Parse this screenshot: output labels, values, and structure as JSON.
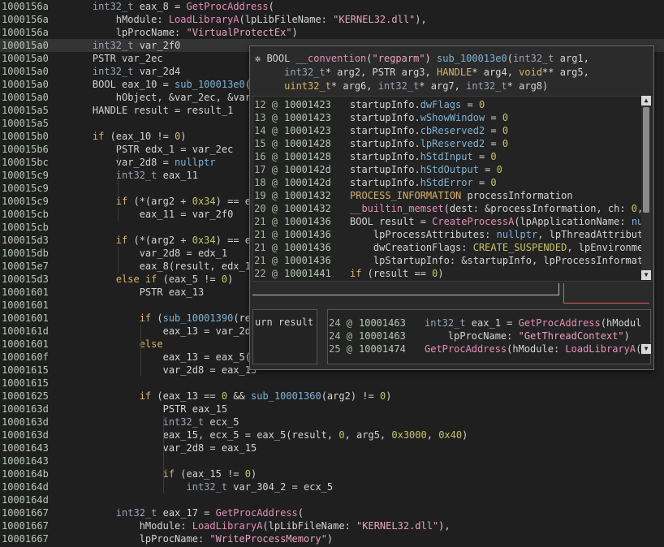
{
  "main_rows": [
    {
      "addr": "1000156a",
      "code": [
        [
          "    ",
          "d"
        ],
        [
          "int32_t",
          "t"
        ],
        [
          " eax_8 = ",
          "d"
        ],
        [
          "GetProcAddress",
          "f"
        ],
        [
          "(",
          "d"
        ]
      ]
    },
    {
      "addr": "1000156a",
      "code": [
        [
          "        hModule: ",
          "d"
        ],
        [
          "LoadLibraryA",
          "f"
        ],
        [
          "(lpLibFileName: ",
          "d"
        ],
        [
          "\"KERNEL32.dll\"",
          "s"
        ],
        [
          "),",
          "d"
        ]
      ]
    },
    {
      "addr": "1000156a",
      "code": [
        [
          "        lpProcName: ",
          "d"
        ],
        [
          "\"VirtualProtectEx\"",
          "s"
        ],
        [
          ")",
          "d"
        ]
      ]
    },
    {
      "addr": "100015a0",
      "code": [
        [
          "    ",
          "d"
        ],
        [
          "int32_t",
          "t"
        ],
        [
          " var_2f0",
          "d"
        ]
      ],
      "hl": true
    },
    {
      "addr": "100015a0",
      "code": [
        [
          "    PSTR var_2ec",
          "d"
        ]
      ]
    },
    {
      "addr": "100015a0",
      "code": [
        [
          "    ",
          "d"
        ],
        [
          "int32_t",
          "t"
        ],
        [
          " var_2d4",
          "d"
        ]
      ]
    },
    {
      "addr": "100015a0",
      "code": [
        [
          "    BOOL eax_10 = ",
          "d"
        ],
        [
          "sub_100013e0",
          "fld"
        ],
        [
          "(8",
          "d"
        ]
      ]
    },
    {
      "addr": "100015a0",
      "code": [
        [
          "        hObject, &var_2ec, &var_",
          "d"
        ]
      ]
    },
    {
      "addr": "100015a5",
      "code": [
        [
          "    HANDLE result = result_1",
          "d"
        ]
      ]
    },
    {
      "addr": "100015a5",
      "code": [
        [
          "",
          "d"
        ]
      ]
    },
    {
      "addr": "100015b0",
      "code": [
        [
          "    ",
          "d"
        ],
        [
          "if",
          "k"
        ],
        [
          " (eax_10 != ",
          "d"
        ],
        [
          "0",
          "n"
        ],
        [
          ")",
          "d"
        ]
      ]
    },
    {
      "addr": "100015b6",
      "code": [
        [
          "        PSTR edx_1 = var_2ec",
          "d"
        ]
      ]
    },
    {
      "addr": "100015bc",
      "code": [
        [
          "        var_2d8 = ",
          "d"
        ],
        [
          "nullptr",
          "fld"
        ]
      ]
    },
    {
      "addr": "100015c9",
      "code": [
        [
          "        ",
          "d"
        ],
        [
          "int32_t",
          "t"
        ],
        [
          " eax_11",
          "d"
        ]
      ]
    },
    {
      "addr": "100015c9",
      "code": [
        [
          "",
          "d"
        ]
      ]
    },
    {
      "addr": "100015c9",
      "code": [
        [
          "        ",
          "d"
        ],
        [
          "if",
          "k"
        ],
        [
          " (*(arg2 + ",
          "d"
        ],
        [
          "0x34",
          "n"
        ],
        [
          ") == ed",
          "d"
        ]
      ]
    },
    {
      "addr": "100015cb",
      "code": [
        [
          "            eax_11 = var_2f0",
          "d"
        ]
      ]
    },
    {
      "addr": "100015cb",
      "code": [
        [
          "",
          "d"
        ]
      ]
    },
    {
      "addr": "100015d3",
      "code": [
        [
          "        ",
          "d"
        ],
        [
          "if",
          "k"
        ],
        [
          " (*(arg2 + ",
          "d"
        ],
        [
          "0x34",
          "n"
        ],
        [
          ") == ed",
          "d"
        ]
      ]
    },
    {
      "addr": "100015db",
      "code": [
        [
          "            var_2d8 = edx_1",
          "d"
        ]
      ]
    },
    {
      "addr": "100015e7",
      "code": [
        [
          "            eax_8(result, edx_1,",
          "d"
        ]
      ]
    },
    {
      "addr": "100015d3",
      "code": [
        [
          "        ",
          "d"
        ],
        [
          "else if",
          "k"
        ],
        [
          " (eax_5 != ",
          "d"
        ],
        [
          "0",
          "n"
        ],
        [
          ")",
          "d"
        ]
      ]
    },
    {
      "addr": "10001601",
      "code": [
        [
          "            PSTR eax_13",
          "d"
        ]
      ]
    },
    {
      "addr": "10001601",
      "code": [
        [
          "",
          "d"
        ]
      ]
    },
    {
      "addr": "10001601",
      "code": [
        [
          "            ",
          "d"
        ],
        [
          "if",
          "k"
        ],
        [
          " (",
          "d"
        ],
        [
          "sub_10001390",
          "fld"
        ],
        [
          "(res",
          "d"
        ]
      ]
    },
    {
      "addr": "1000161d",
      "code": [
        [
          "                eax_13 = var_2d8",
          "d"
        ]
      ]
    },
    {
      "addr": "10001601",
      "code": [
        [
          "            ",
          "d"
        ],
        [
          "else",
          "k"
        ]
      ]
    },
    {
      "addr": "1000160f",
      "code": [
        [
          "                eax_13 = eax_5(r",
          "d"
        ]
      ]
    },
    {
      "addr": "10001615",
      "code": [
        [
          "                var_2d8 = eax_13",
          "d"
        ]
      ]
    },
    {
      "addr": "10001615",
      "code": [
        [
          "",
          "d"
        ]
      ]
    },
    {
      "addr": "10001625",
      "code": [
        [
          "            ",
          "d"
        ],
        [
          "if",
          "k"
        ],
        [
          " (eax_13 == ",
          "d"
        ],
        [
          "0",
          "n"
        ],
        [
          " && ",
          "d"
        ],
        [
          "sub_10001360",
          "fld"
        ],
        [
          "(arg2) != ",
          "d"
        ],
        [
          "0",
          "n"
        ],
        [
          ")",
          "d"
        ]
      ]
    },
    {
      "addr": "1000163d",
      "code": [
        [
          "                PSTR eax_15",
          "d"
        ]
      ]
    },
    {
      "addr": "1000163d",
      "code": [
        [
          "                ",
          "d"
        ],
        [
          "int32_t",
          "t"
        ],
        [
          " ecx_5",
          "d"
        ]
      ]
    },
    {
      "addr": "1000163d",
      "code": [
        [
          "                eax_15, ecx_5 = eax_5(result, ",
          "d"
        ],
        [
          "0",
          "n"
        ],
        [
          ", arg5, ",
          "d"
        ],
        [
          "0x3000",
          "n"
        ],
        [
          ", ",
          "d"
        ],
        [
          "0x40",
          "n"
        ],
        [
          ")",
          "d"
        ]
      ]
    },
    {
      "addr": "10001643",
      "code": [
        [
          "                var_2d8 = eax_15",
          "d"
        ]
      ]
    },
    {
      "addr": "10001643",
      "code": [
        [
          "",
          "d"
        ]
      ]
    },
    {
      "addr": "1000164b",
      "code": [
        [
          "                ",
          "d"
        ],
        [
          "if",
          "k"
        ],
        [
          " (eax_15 != ",
          "d"
        ],
        [
          "0",
          "n"
        ],
        [
          ")",
          "d"
        ]
      ]
    },
    {
      "addr": "1000164d",
      "code": [
        [
          "                    ",
          "d"
        ],
        [
          "int32_t",
          "t"
        ],
        [
          " var_304_2 = ecx_5",
          "d"
        ]
      ]
    },
    {
      "addr": "1000164d",
      "code": [
        [
          "",
          "d"
        ]
      ]
    },
    {
      "addr": "10001667",
      "code": [
        [
          "        ",
          "d"
        ],
        [
          "int32_t",
          "t"
        ],
        [
          " eax_17 = ",
          "d"
        ],
        [
          "GetProcAddress",
          "f"
        ],
        [
          "(",
          "d"
        ]
      ]
    },
    {
      "addr": "10001667",
      "code": [
        [
          "            hModule: ",
          "d"
        ],
        [
          "LoadLibraryA",
          "f"
        ],
        [
          "(lpLibFileName: ",
          "d"
        ],
        [
          "\"KERNEL32.dll\"",
          "s"
        ],
        [
          "),",
          "d"
        ]
      ]
    },
    {
      "addr": "10001667",
      "code": [
        [
          "            lpProcName: ",
          "d"
        ],
        [
          "\"WriteProcessMemory\"",
          "s"
        ],
        [
          ")",
          "d"
        ]
      ]
    }
  ],
  "popup": {
    "header": [
      [
        [
          "✲ ",
          "d"
        ],
        [
          "BOOL ",
          "d"
        ],
        [
          "__convention",
          "f"
        ],
        [
          "(",
          "d"
        ],
        [
          "\"regparm\"",
          "s"
        ],
        [
          ") ",
          "d"
        ],
        [
          "sub_100013e0",
          "fld"
        ],
        [
          "(",
          "d"
        ],
        [
          "int32_t",
          "t"
        ],
        [
          " arg1,",
          "d"
        ]
      ],
      [
        [
          "     ",
          "d"
        ],
        [
          "int32_t",
          "t"
        ],
        [
          "* arg2, ",
          "d"
        ],
        [
          "PSTR",
          "d"
        ],
        [
          " arg3, ",
          "d"
        ],
        [
          "HANDLE",
          "c"
        ],
        [
          "* arg4, ",
          "d"
        ],
        [
          "void",
          "k"
        ],
        [
          "** arg5,",
          "d"
        ]
      ],
      [
        [
          "     ",
          "d"
        ],
        [
          "uint32_t",
          "c"
        ],
        [
          "* arg6, ",
          "d"
        ],
        [
          "int32_t",
          "t"
        ],
        [
          "* arg7, ",
          "d"
        ],
        [
          "int32_t",
          "t"
        ],
        [
          "* arg8)",
          "d"
        ]
      ]
    ],
    "rows": [
      {
        "ln": "12",
        "addr": "10001423",
        "code": [
          [
            "startupInfo.",
            "d"
          ],
          [
            "dwFlags",
            "fld"
          ],
          [
            " = ",
            "d"
          ],
          [
            "0",
            "n"
          ]
        ]
      },
      {
        "ln": "13",
        "addr": "10001423",
        "code": [
          [
            "startupInfo.",
            "d"
          ],
          [
            "wShowWindow",
            "fld"
          ],
          [
            " = ",
            "d"
          ],
          [
            "0",
            "n"
          ]
        ]
      },
      {
        "ln": "14",
        "addr": "10001423",
        "code": [
          [
            "startupInfo.",
            "d"
          ],
          [
            "cbReserved2",
            "fld"
          ],
          [
            " = ",
            "d"
          ],
          [
            "0",
            "n"
          ]
        ]
      },
      {
        "ln": "15",
        "addr": "10001428",
        "code": [
          [
            "startupInfo.",
            "d"
          ],
          [
            "lpReserved2",
            "fld"
          ],
          [
            " = ",
            "d"
          ],
          [
            "0",
            "n"
          ]
        ]
      },
      {
        "ln": "16",
        "addr": "10001428",
        "code": [
          [
            "startupInfo.",
            "d"
          ],
          [
            "hStdInput",
            "fld"
          ],
          [
            " = ",
            "d"
          ],
          [
            "0",
            "n"
          ]
        ]
      },
      {
        "ln": "17",
        "addr": "1000142d",
        "code": [
          [
            "startupInfo.",
            "d"
          ],
          [
            "hStdOutput",
            "fld"
          ],
          [
            " = ",
            "d"
          ],
          [
            "0",
            "n"
          ]
        ]
      },
      {
        "ln": "18",
        "addr": "1000142d",
        "code": [
          [
            "startupInfo.",
            "d"
          ],
          [
            "hStdError",
            "fld"
          ],
          [
            " = ",
            "d"
          ],
          [
            "0",
            "n"
          ]
        ]
      },
      {
        "ln": "19",
        "addr": "10001432",
        "code": [
          [
            "PROCESS_INFORMATION",
            "c"
          ],
          [
            " processInformation",
            "d"
          ]
        ]
      },
      {
        "ln": "20",
        "addr": "10001432",
        "code": [
          [
            "__builtin_memset",
            "f"
          ],
          [
            "(dest: &processInformation, ch: ",
            "d"
          ],
          [
            "0",
            "n"
          ],
          [
            ",",
            "d"
          ]
        ]
      },
      {
        "ln": "21",
        "addr": "10001436",
        "code": [
          [
            "BOOL result = ",
            "d"
          ],
          [
            "CreateProcessA",
            "f"
          ],
          [
            "(lpApplicationName: ",
            "d"
          ],
          [
            "nul",
            "fld"
          ]
        ]
      },
      {
        "ln": "21",
        "addr": "10001436",
        "code": [
          [
            "    lpProcessAttributes: ",
            "d"
          ],
          [
            "nullptr",
            "fld"
          ],
          [
            ", lpThreadAttribute",
            "d"
          ]
        ]
      },
      {
        "ln": "21",
        "addr": "10001436",
        "code": [
          [
            "    dwCreationFlags: ",
            "d"
          ],
          [
            "CREATE_SUSPENDED",
            "n"
          ],
          [
            ", lpEnvironmen",
            "d"
          ]
        ]
      },
      {
        "ln": "21",
        "addr": "10001436",
        "code": [
          [
            "    lpStartupInfo: &startupInfo, lpProcessInformati",
            "d"
          ]
        ]
      },
      {
        "ln": "22",
        "addr": "10001441",
        "code": [
          [
            "if",
            "k"
          ],
          [
            " (result == ",
            "d"
          ],
          [
            "0",
            "n"
          ],
          [
            ")",
            "d"
          ]
        ]
      }
    ],
    "left_snip": "urn result",
    "right_rows": [
      {
        "ln": "24",
        "addr": "10001463",
        "code": [
          [
            "int32_t",
            "t"
          ],
          [
            " eax_1 = ",
            "d"
          ],
          [
            "GetProcAddress",
            "f"
          ],
          [
            "(hModul",
            "d"
          ]
        ]
      },
      {
        "ln": "24",
        "addr": "10001463",
        "code": [
          [
            "    lpProcName: ",
            "d"
          ],
          [
            "\"GetThreadContext\"",
            "s"
          ],
          [
            ")",
            "d"
          ]
        ]
      },
      {
        "ln": "25",
        "addr": "10001474",
        "code": [
          [
            "GetProcAddress",
            "f"
          ],
          [
            "(hModule: ",
            "d"
          ],
          [
            "LoadLibraryA",
            "f"
          ],
          [
            "(",
            "d"
          ]
        ]
      }
    ]
  }
}
